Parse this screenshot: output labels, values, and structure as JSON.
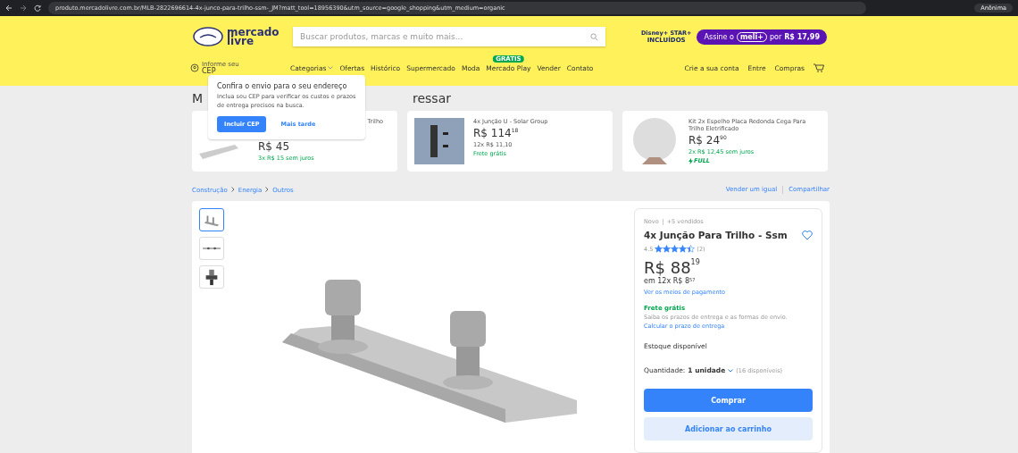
{
  "browser": {
    "url": "produto.mercadolivre.com.br/MLB-2822696614-4x-junco-para-trilho-ssm-_JM?matt_tool=18956390&utm_source=google_shopping&utm_medium=organic",
    "profile": "Anônima"
  },
  "header": {
    "logo_line1": "mercado",
    "logo_line2": "livre",
    "search": {
      "placeholder": "Buscar produtos, marcas e muito mais..."
    },
    "promo_brand": "Disney+ STAR+",
    "promo_sub": "INCLUÍDOS",
    "promo": {
      "before": "Assine o",
      "badge": "meli+",
      "after": "por",
      "price": "R$ 17,99"
    },
    "location_line1": "Informe seu",
    "location_line2": "CEP",
    "nav": [
      {
        "label": "Categorias",
        "dropdown": true
      },
      {
        "label": "Ofertas",
        "dropdown": false
      },
      {
        "label": "Histórico",
        "dropdown": false
      },
      {
        "label": "Supermercado",
        "dropdown": false
      },
      {
        "label": "Moda",
        "dropdown": false
      },
      {
        "label": "Mercado Play",
        "dropdown": false,
        "badge": "GRÁTIS"
      },
      {
        "label": "Vender",
        "dropdown": false
      },
      {
        "label": "Contato",
        "dropdown": false
      }
    ],
    "account": [
      "Crie a sua conta",
      "Entre",
      "Compras"
    ]
  },
  "related": {
    "heading_start": "M",
    "heading_end": "ressar",
    "cards": [
      {
        "title": "Trilho",
        "price": "R$ 45",
        "installments": "3x R$ 15 sem juros",
        "kind": "rail"
      },
      {
        "title": "4x Junção U - Solar Group",
        "price": "R$ 114",
        "cents": "18",
        "installments": "12x R$ 11,10",
        "shipping": "Frete grátis",
        "kind": "bracket"
      },
      {
        "title": "Kit 2x Espelho Placa Redonda Cega Para Trilho Eletrificado",
        "price": "R$ 24",
        "cents": "90",
        "installments": "2x R$ 12,45 sem juros",
        "full": "FULL",
        "kind": "disc"
      }
    ]
  },
  "popup": {
    "title": "Confira o envio para o seu endereço",
    "text": "Inclua seu CEP para verificar os custos e prazos de entrega precisos na busca.",
    "primary": "Incluir CEP",
    "secondary": "Mais tarde"
  },
  "breadcrumb": [
    "Construção",
    "Energia",
    "Outros"
  ],
  "actions": [
    "Vender um igual",
    "Compartilhar"
  ],
  "thumbnails": [
    {
      "kind": "rail",
      "selected": true
    },
    {
      "kind": "line",
      "selected": false
    },
    {
      "kind": "clamp",
      "selected": false
    }
  ],
  "product": {
    "condition": "Novo",
    "sold": "+5 vendidos",
    "title": "4x Junção Para Trilho - Ssm",
    "rating": "4.5",
    "stars": 4.5,
    "reviews": "(2)",
    "price": "R$ 88",
    "cents": "19",
    "installments": "em 12x R$ 8",
    "installment_cents": "57",
    "payment_link": "Ver os meios de pagamento",
    "shipping": "Frete grátis",
    "shipping_text": "Saiba os prazos de entrega e as formas de envio.",
    "shipping_link": "Calcular o prazo de entrega",
    "stock": "Estoque disponível",
    "quantity_label": "Quantidade:",
    "quantity": "1 unidade",
    "available": "(16 disponíveis)",
    "buy": "Comprar",
    "cart": "Adicionar ao carrinho"
  }
}
